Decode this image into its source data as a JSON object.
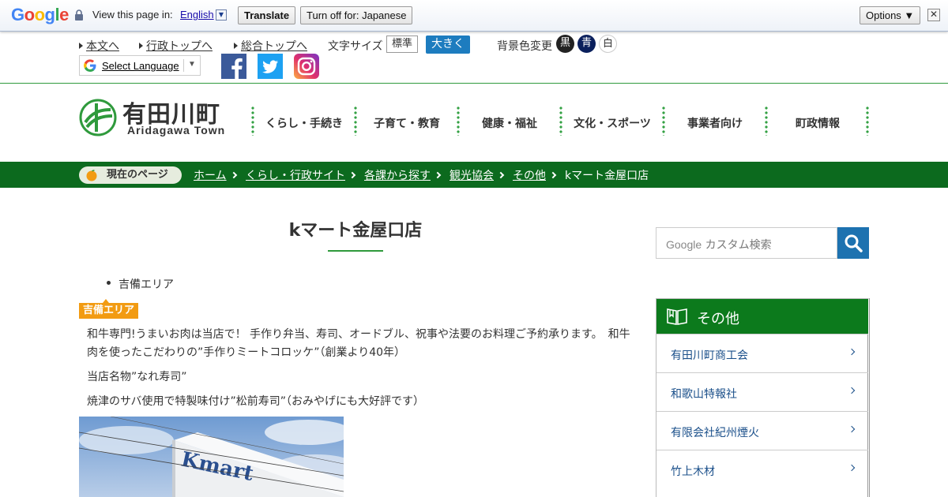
{
  "translate_bar": {
    "logo": "Google",
    "prompt": "View this page in:",
    "language": "English",
    "translate_label": "Translate",
    "turn_off_label": "Turn off for: Japanese",
    "options_label": "Options ▼"
  },
  "utility": {
    "links": [
      "本文へ",
      "行政トップへ",
      "総合トップへ"
    ],
    "font_size_label": "文字サイズ",
    "font_normal": "標準",
    "font_large": "大きく",
    "bg_label": "背景色変更",
    "bg_black": "黒",
    "bg_blue": "青",
    "bg_white": "白",
    "select_language": "Select Language"
  },
  "site": {
    "name_jp": "有田川町",
    "name_en": "Aridagawa Town",
    "nav": [
      "くらし・手続き",
      "子育て・教育",
      "健康・福祉",
      "文化・スポーツ",
      "事業者向け",
      "町政情報"
    ]
  },
  "breadcrumb": {
    "here_label": "現在のページ",
    "links": [
      "ホーム",
      "くらし・行政サイト",
      "各課から探す",
      "観光協会",
      "その他"
    ],
    "current": "kマート金屋口店"
  },
  "main": {
    "title": "kマート金屋口店",
    "bullet": "吉備エリア",
    "area_tag": "吉備エリア",
    "paragraphs": [
      "和牛専門!うまいお肉は当店で！ 手作り弁当、寿司、オードブル、祝事や法要のお料理ご予約承ります。　和牛肉を使ったこだわりの”手作りミートコロッケ”（創業より40年）",
      "当店名物”なれ寿司”",
      "焼津のサバ使用で特製味付け”松前寿司”（おみやげにも大好評です）"
    ],
    "photo_sign": "Kmart"
  },
  "side": {
    "search_brand": "Google",
    "search_placeholder": "カスタム検索",
    "panel_title": "その他",
    "items": [
      "有田川町商工会",
      "和歌山特報社",
      "有限会社紀州煙火",
      "竹上木材"
    ]
  },
  "colors": {
    "accent_green": "#0c6a1e",
    "accent_blue": "#1d7cbf",
    "tag_orange": "#f29b12"
  }
}
